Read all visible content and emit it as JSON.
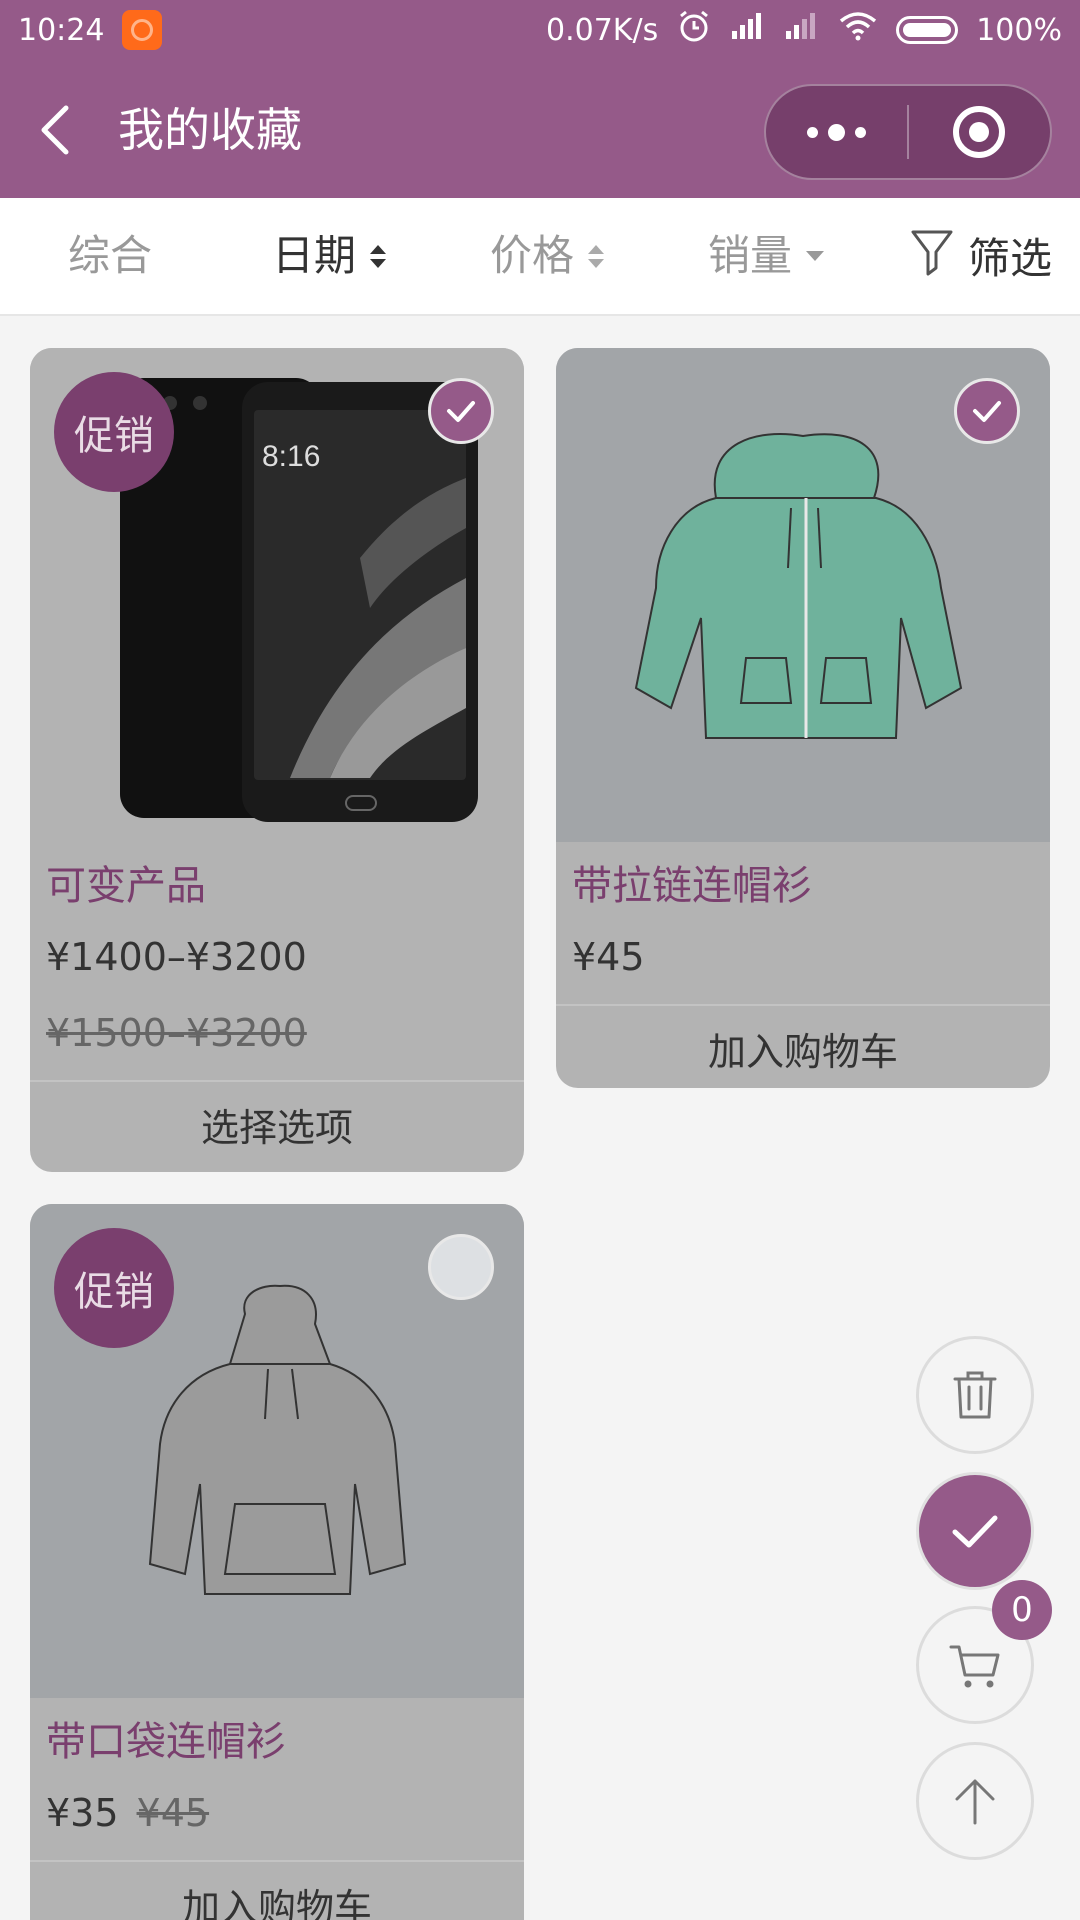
{
  "status_bar": {
    "time": "10:24",
    "speed": "0.07K/s",
    "battery": "100%"
  },
  "nav": {
    "title": "我的收藏"
  },
  "sort": {
    "items": [
      {
        "label": "综合"
      },
      {
        "label": "日期"
      },
      {
        "label": "价格"
      },
      {
        "label": "销量"
      },
      {
        "label": "筛选"
      }
    ]
  },
  "products": [
    {
      "promo": "促销",
      "name": "可变产品",
      "price": "¥1400–¥3200",
      "old_price": "¥1500–¥3200",
      "action": "选择选项",
      "selected": true
    },
    {
      "name": "带拉链连帽衫",
      "price": "¥45",
      "action": "加入购物车",
      "selected": true
    },
    {
      "promo": "促销",
      "name": "带口袋连帽衫",
      "price": "¥35",
      "old_price": "¥45",
      "action": "加入购物车",
      "selected": false
    }
  ],
  "cart": {
    "count": "0"
  },
  "colors": {
    "accent": "#955a89",
    "promo": "#7a3f6e"
  }
}
